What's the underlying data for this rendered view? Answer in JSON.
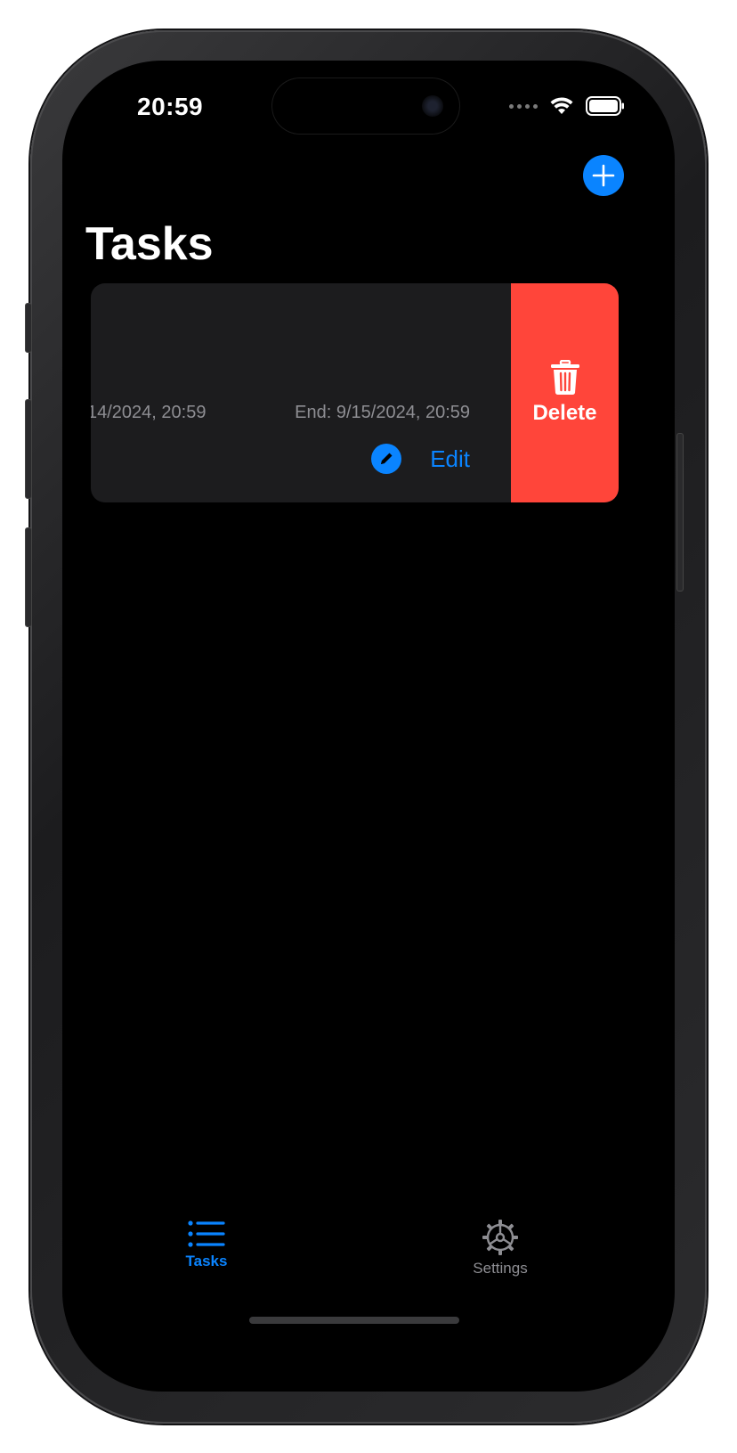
{
  "status_bar": {
    "time": "20:59"
  },
  "header": {
    "title": "Tasks",
    "add_icon": "plus-icon"
  },
  "task": {
    "start_text": "14/2024, 20:59",
    "end_text": "End: 9/15/2024, 20:59",
    "edit_label": "Edit",
    "delete_label": "Delete"
  },
  "tab_bar": {
    "items": [
      {
        "label": "Tasks",
        "icon": "list-icon",
        "active": true
      },
      {
        "label": "Settings",
        "icon": "gear-icon",
        "active": false
      }
    ]
  },
  "colors": {
    "accent": "#0a84ff",
    "destructive": "#ff453a",
    "card_bg": "#1c1c1e",
    "secondary_text": "#8e8e93",
    "inactive_tab": "#8e8e93"
  }
}
